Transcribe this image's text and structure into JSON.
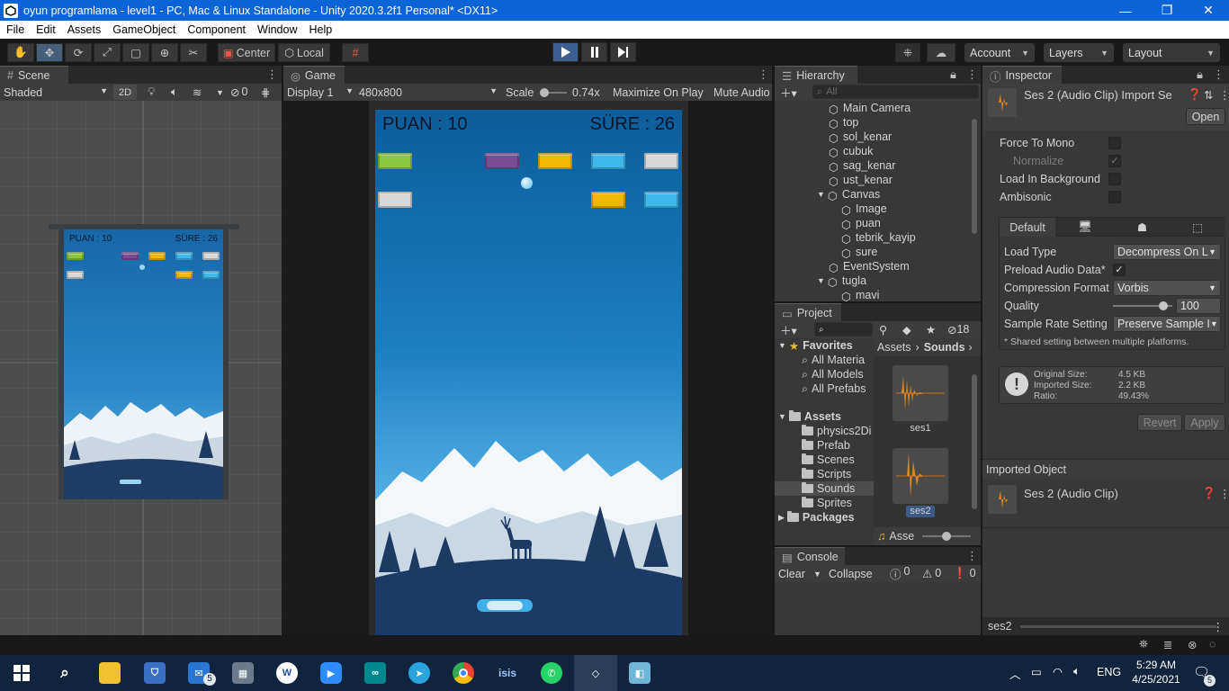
{
  "window": {
    "title": "oyun programlama - level1 - PC, Mac & Linux Standalone - Unity 2020.3.2f1 Personal* <DX11>",
    "minimize": "—",
    "restore": "❐",
    "close": "✕"
  },
  "menu": [
    "File",
    "Edit",
    "Assets",
    "GameObject",
    "Component",
    "Window",
    "Help"
  ],
  "toolbar": {
    "center": "Center",
    "local": "Local",
    "account": "Account",
    "layers": "Layers",
    "layout": "Layout"
  },
  "scene": {
    "tab": "Scene",
    "shading": "Shaded",
    "mode_2d": "2D",
    "hidden_count": "0",
    "hud_score": "PUAN : 10",
    "hud_time": "SÜRE : 26"
  },
  "game": {
    "tab": "Game",
    "display": "Display 1",
    "resolution": "480x800",
    "scale_label": "Scale",
    "scale_value": "0.74x",
    "maximize": "Maximize On Play",
    "mute": "Mute Audio",
    "hud_score": "PUAN : 10",
    "hud_time": "SÜRE : 26"
  },
  "hierarchy": {
    "tab": "Hierarchy",
    "search_placeholder": "All",
    "items": [
      "Main Camera",
      "top",
      "sol_kenar",
      "cubuk",
      "sag_kenar",
      "ust_kenar",
      "Canvas",
      "Image",
      "puan",
      "tebrik_kayip",
      "sure",
      "EventSystem",
      "tugla",
      "mavi"
    ]
  },
  "project": {
    "tab": "Project",
    "hidden_count": "18",
    "favorites": "Favorites",
    "fav_items": [
      "All Materia",
      "All Models",
      "All Prefabs"
    ],
    "assets": "Assets",
    "asset_items": [
      "physics2Di",
      "Prefab",
      "Scenes",
      "Scripts",
      "Sounds",
      "Sprites"
    ],
    "packages": "Packages",
    "breadcrumb": [
      "Assets",
      "Sounds"
    ],
    "files": [
      "ses1",
      "ses2"
    ],
    "footer": "Asse"
  },
  "console": {
    "tab": "Console",
    "clear": "Clear",
    "collapse": "Collapse",
    "logs": "0",
    "warnings": "0",
    "errors": "0"
  },
  "inspector": {
    "tab": "Inspector",
    "title": "Ses 2 (Audio Clip) Import Se",
    "open": "Open",
    "force_mono": "Force To Mono",
    "normalize": "Normalize",
    "load_bg": "Load In Background",
    "ambisonic": "Ambisonic",
    "platform_default": "Default",
    "load_type_label": "Load Type",
    "load_type_value": "Decompress On L",
    "preload_label": "Preload Audio Data*",
    "compression_label": "Compression Format",
    "compression_value": "Vorbis",
    "quality_label": "Quality",
    "quality_value": "100",
    "quality_fraction": 0.85,
    "sample_rate_label": "Sample Rate Setting",
    "sample_rate_value": "Preserve Sample I",
    "shared_note": "* Shared setting between multiple platforms.",
    "original_size_label": "Original Size:",
    "original_size": "4.5 KB",
    "imported_size_label": "Imported Size:",
    "imported_size": "2.2 KB",
    "ratio_label": "Ratio:",
    "ratio": "49.43%",
    "revert": "Revert",
    "apply": "Apply",
    "imported_object": "Imported Object",
    "imported_name": "Ses 2 (Audio Clip)",
    "preview_name": "ses2"
  },
  "taskbar": {
    "time": "5:29 AM",
    "date": "4/25/2021",
    "lang": "ENG",
    "mail_badge": "5",
    "notif_badge": "5"
  }
}
